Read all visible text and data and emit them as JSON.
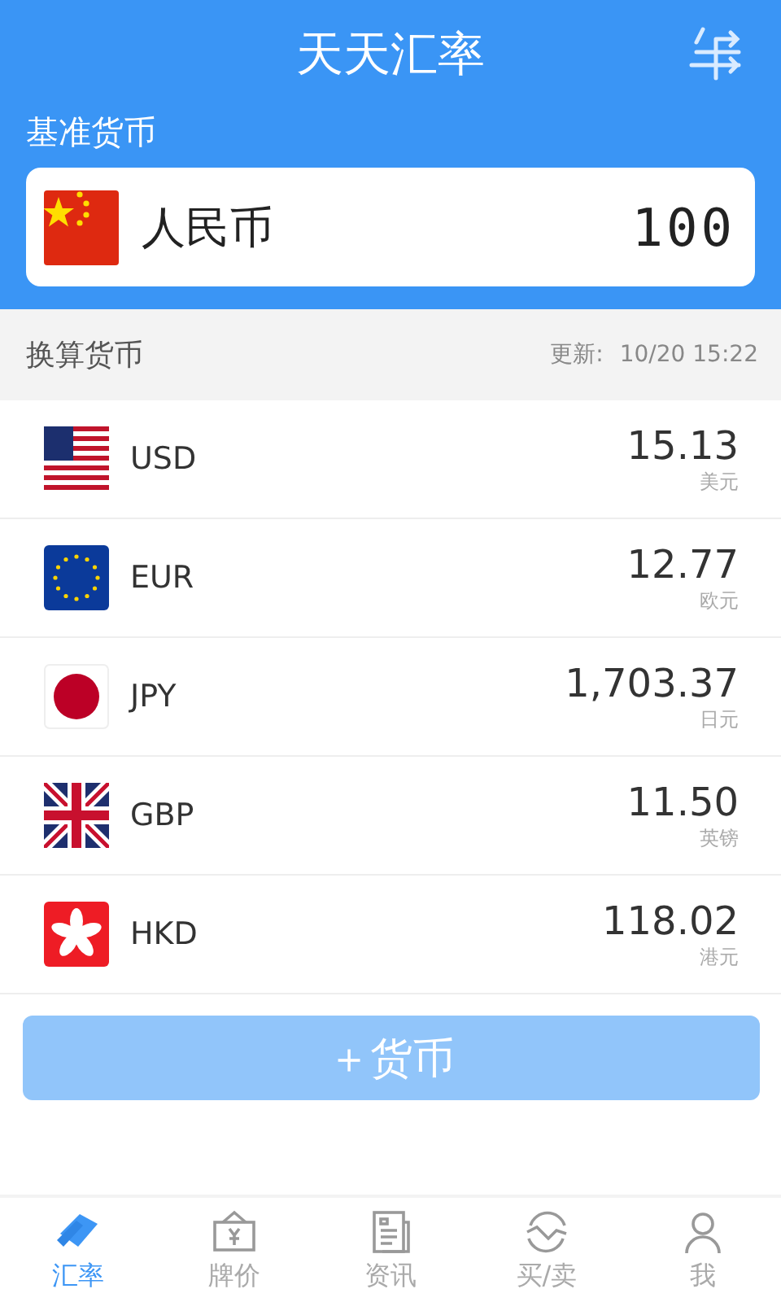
{
  "header": {
    "title": "天天汇率"
  },
  "base": {
    "label": "基准货币",
    "currency": "人民币",
    "amount": "100"
  },
  "list_header": {
    "title": "换算货币",
    "updated_label": "更新:",
    "updated_time": "10/20 15:22"
  },
  "rates": [
    {
      "code": "USD",
      "value": "15.13",
      "name": "美元"
    },
    {
      "code": "EUR",
      "value": "12.77",
      "name": "欧元"
    },
    {
      "code": "JPY",
      "value": "1,703.37",
      "name": "日元"
    },
    {
      "code": "GBP",
      "value": "11.50",
      "name": "英镑"
    },
    {
      "code": "HKD",
      "value": "118.02",
      "name": "港元"
    }
  ],
  "add_button": {
    "label": "＋货币"
  },
  "tabs": [
    {
      "label": "汇率",
      "selected": true
    },
    {
      "label": "牌价",
      "selected": false
    },
    {
      "label": "资讯",
      "selected": false
    },
    {
      "label": "买/卖",
      "selected": false
    },
    {
      "label": "我",
      "selected": false
    }
  ]
}
